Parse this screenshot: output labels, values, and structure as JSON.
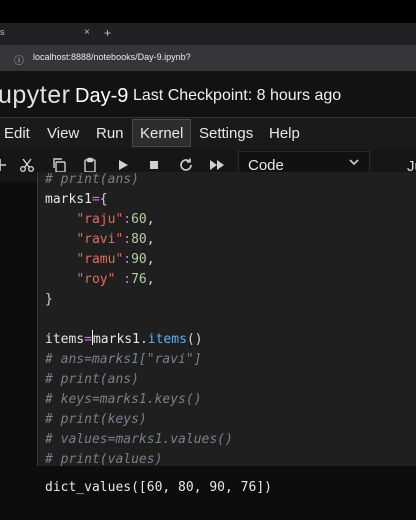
{
  "browser": {
    "tab_tail": "s",
    "tab_close": "×",
    "new_tab": "+",
    "url": "localhost:8888/notebooks/Day-9.ipynb?"
  },
  "header": {
    "logo_text": "upyter",
    "notebook_title": "Day-9",
    "checkpoint": "Last Checkpoint: 8 hours ago"
  },
  "menu": [
    "Edit",
    "View",
    "Run",
    "Kernel",
    "Settings",
    "Help"
  ],
  "menu_active": "Kernel",
  "toolbar": {
    "cell_type": "Code",
    "kernel_partial": "Ju"
  },
  "code": {
    "line0_partial": "# print(ans)",
    "dict_name": "marks1",
    "entries": [
      {
        "key": "\"raju\"",
        "value": "60",
        "sep": ":"
      },
      {
        "key": "\"ravi\"",
        "value": "80",
        "sep": ":"
      },
      {
        "key": "\"ramu\"",
        "value": "90",
        "sep": ":"
      },
      {
        "key": "\"roy\"",
        "value": "76",
        "sep": " :"
      }
    ],
    "items_line_left": "items",
    "items_line_obj": "marks1",
    "items_line_attr": "items",
    "comments": [
      "# ans=marks1[\"ravi\"]",
      "# print(ans)",
      "# keys=marks1.keys()",
      "# print(keys)",
      "# values=marks1.values()",
      "# print(values)"
    ]
  },
  "output": "dict_values([60, 80, 90, 76])"
}
